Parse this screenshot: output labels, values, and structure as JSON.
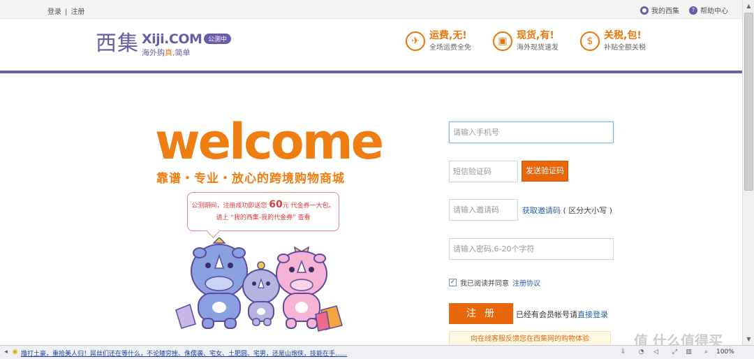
{
  "topbar": {
    "login": "登录",
    "register": "注册",
    "my_xiji": "我的西集",
    "help": "帮助中心"
  },
  "logo": {
    "cn": "西集",
    "en": "Xiji.COM",
    "slogan_prefix": "海外购",
    "slogan_highlight": "真,",
    "slogan_suffix": "简单",
    "badge": "公测中"
  },
  "promos": [
    {
      "title": "运费,无!",
      "subtitle": "全场运费全免",
      "icon": "plane-icon"
    },
    {
      "title": "现货,有!",
      "subtitle": "海外现货速发",
      "icon": "box-icon"
    },
    {
      "title": "关税,包!",
      "subtitle": "补贴全额关税",
      "icon": "money-bag-icon"
    }
  ],
  "hero": {
    "welcome": "welcome",
    "tagline": "靠谱・专业・放心的跨境购物商城",
    "bubble_line1_pre": "公测期间，注册成功即送您",
    "bubble_amount": "60",
    "bubble_line1_post": "元 代金券一大包。",
    "bubble_line2": "请上 “我的西集-我的代金券” 查看"
  },
  "form": {
    "phone_placeholder": "请输入手机号",
    "sms_placeholder": "短信验证码",
    "send_code": "发送验证码",
    "invite_placeholder": "请输入邀请码",
    "get_invite": "获取邀请码",
    "case_hint": "( 区分大小写 )",
    "password_placeholder": "请输入密码,6-20个字符",
    "agree_text": "我已阅读并同意",
    "agreement_link": "注册协议",
    "register_button": "注册",
    "have_account": "已经有会员帐号请",
    "login_link": "直接登录",
    "feedback": "向在线客服反馈您在西集网的购物体验"
  },
  "statusbar": {
    "news": "撸打土豪，重拾美人归！屌丝们还在等什么，不论矮穷挫、侏儒袭、宅女、土肥圆、宅男，还是山炮侠，技能在手......",
    "zoom": "100%"
  },
  "watermark": "值 什么值得买",
  "colors": {
    "brand_purple": "#6b5aa6",
    "accent_orange": "#e8670b"
  }
}
